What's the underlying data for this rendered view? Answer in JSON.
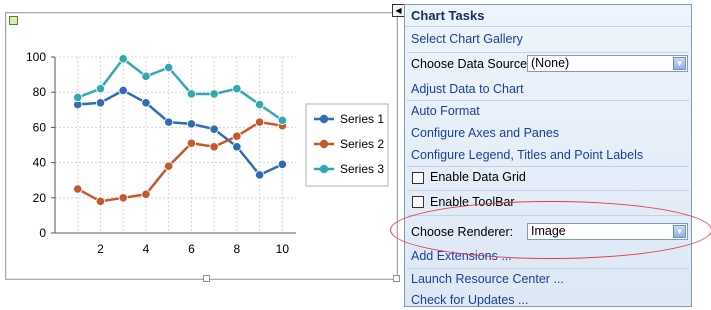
{
  "chart_data": {
    "type": "line",
    "x": [
      1,
      2,
      3,
      4,
      5,
      6,
      7,
      8,
      9,
      10
    ],
    "series": [
      {
        "name": "Series 1",
        "color": "#2e6db4",
        "values": [
          73,
          74,
          81,
          74,
          63,
          62,
          59,
          49,
          33,
          39
        ]
      },
      {
        "name": "Series 2",
        "color": "#c45a2c",
        "values": [
          25,
          18,
          20,
          22,
          38,
          51,
          49,
          55,
          63,
          61
        ]
      },
      {
        "name": "Series 3",
        "color": "#34a8b0",
        "values": [
          77,
          82,
          99,
          89,
          94,
          79,
          79,
          82,
          73,
          64
        ]
      }
    ],
    "xlim": [
      0,
      10.6
    ],
    "ylim": [
      0,
      100
    ],
    "x_ticks": [
      "2",
      "4",
      "6",
      "8",
      "10"
    ],
    "y_ticks": [
      "0",
      "20",
      "40",
      "60",
      "80",
      "100"
    ],
    "grid": true,
    "legend": "right",
    "title": "",
    "xlabel": "",
    "ylabel": ""
  },
  "task_panel": {
    "title": "Chart Tasks",
    "select_gallery": "Select Chart Gallery",
    "data_source_label": "Choose Data Source:",
    "data_source_value": "(None)",
    "adjust_data": "Adjust Data to Chart",
    "auto_format": "Auto Format",
    "configure_axes": "Configure Axes and Panes",
    "configure_legend": "Configure Legend, Titles and Point Labels",
    "enable_data_grid": "Enable Data Grid",
    "enable_toolbar": "Enable ToolBar",
    "renderer_label": "Choose Renderer:",
    "renderer_value": "Image",
    "add_extensions": "Add Extensions ...",
    "launch_resource": "Launch Resource Center ...",
    "check_updates": "Check for Updates ..."
  },
  "icons": {
    "smart_tag_arrow": "triangle-left-icon",
    "dropdown_arrow": "chevron-down-icon"
  }
}
